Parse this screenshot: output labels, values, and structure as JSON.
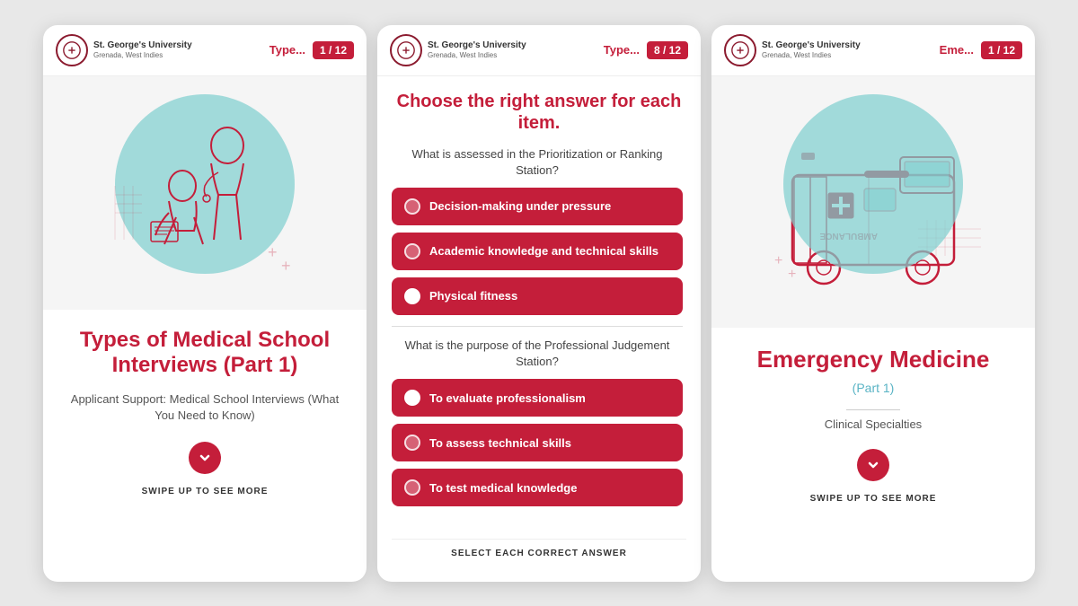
{
  "cards": [
    {
      "id": "card1",
      "header": {
        "university": "St. George's University",
        "sub": "Grenada, West Indies",
        "type_label": "Type...",
        "page": "1 / 12"
      },
      "title": "Types of Medical School Interviews (Part 1)",
      "subtitle": "Applicant Support: Medical School Interviews (What You Need to Know)",
      "swipe_text": "SWIPE UP TO SEE MORE"
    },
    {
      "id": "card2",
      "header": {
        "university": "St. George's University",
        "sub": "Grenada, West Indies",
        "type_label": "Type...",
        "page": "8 / 12"
      },
      "quiz_title": "Choose the right answer for each item.",
      "questions": [
        {
          "text": "What is assessed in the Prioritization or Ranking Station?",
          "answers": [
            {
              "label": "Decision-making under pressure",
              "selected": true
            },
            {
              "label": "Academic knowledge and technical skills",
              "selected": false
            },
            {
              "label": "Physical fitness",
              "selected": true
            }
          ]
        },
        {
          "text": "What is the purpose of the Professional Judgement Station?",
          "answers": [
            {
              "label": "To evaluate professionalism",
              "selected": true
            },
            {
              "label": "To assess technical skills",
              "selected": false
            },
            {
              "label": "To test medical knowledge",
              "selected": false
            }
          ]
        }
      ],
      "select_text": "SELECT EACH CORRECT ANSWER"
    },
    {
      "id": "card3",
      "header": {
        "university": "St. George's University",
        "sub": "Grenada, West Indies",
        "type_label": "Eme...",
        "page": "1 / 12"
      },
      "title": "Emergency Medicine",
      "part": "(Part 1)",
      "category": "Clinical Specialties",
      "swipe_text": "SWIPE UP TO SEE MORE"
    }
  ]
}
